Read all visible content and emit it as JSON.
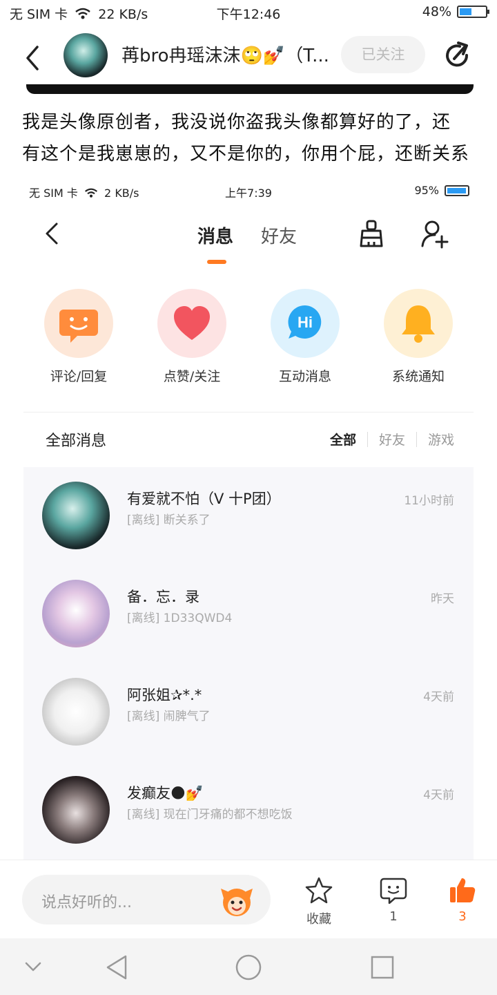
{
  "status_bar": {
    "left": "无 SIM 卡",
    "speed": "22 KB/s",
    "time": "下午12:46",
    "battery_pct": "48%",
    "battery_level": 0.48
  },
  "post": {
    "author": "苒bro冉瑶沫沫🙄💅（T...",
    "follow_label": "已关注",
    "text_line_1": "我是头像原创者，我没说你盗我头像都算好的了，还",
    "text_line_2": "有这个是我崽崽的，又不是你的，你用个屁，还断关系"
  },
  "embedded": {
    "status_bar": {
      "left": "无 SIM 卡",
      "speed": "2 KB/s",
      "time": "上午7:39",
      "battery_pct": "95%",
      "battery_level": 0.95
    },
    "tabs": [
      {
        "label": "消息"
      },
      {
        "label": "好友"
      }
    ],
    "categories": [
      {
        "label": "评论/回复",
        "icon": "comment-smile-icon",
        "bg": "#fde7d8",
        "color": "#ff8c3c"
      },
      {
        "label": "点赞/关注",
        "icon": "heart-icon",
        "bg": "#fde3e3",
        "color": "#f2555f"
      },
      {
        "label": "互动消息",
        "icon": "hi-bubble-icon",
        "bg": "#def2fd",
        "color": "#28a7f2"
      },
      {
        "label": "系统通知",
        "icon": "bell-icon",
        "bg": "#fef0d4",
        "color": "#ffb020"
      }
    ],
    "section_title": "全部消息",
    "filters": [
      "全部",
      "好友",
      "游戏"
    ],
    "messages": [
      {
        "name": "有爱就不怕（V 十P团）",
        "preview": "[离线] 断关系了",
        "time": "11小时前"
      },
      {
        "name": "备．忘．录",
        "preview": "[离线] 1D33QWD4",
        "time": "昨天"
      },
      {
        "name": "阿张姐✰*.*",
        "preview": "[离线] 闹脾气了",
        "time": "4天前"
      },
      {
        "name": "发癫友🌑💅",
        "preview": "[离线] 现在门牙痛的都不想吃饭",
        "time": "4天前"
      }
    ]
  },
  "bottom_bar": {
    "comment_placeholder": "说点好听的...",
    "favorite_label": "收藏",
    "comment_count": "1",
    "like_count": "3",
    "like_color": "#ff6a1a"
  }
}
